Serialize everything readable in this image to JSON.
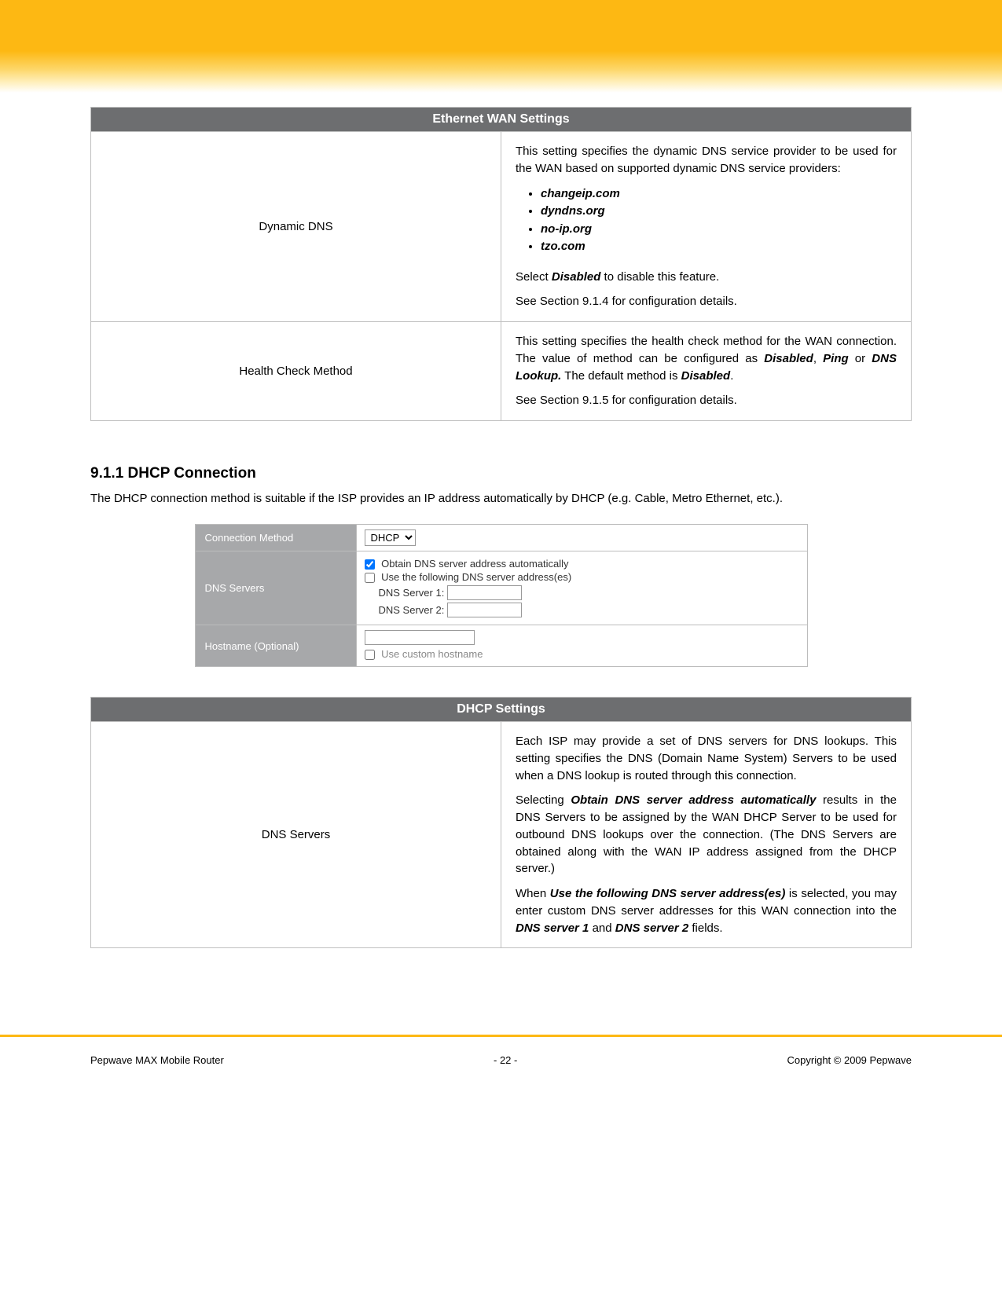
{
  "tables": {
    "ethernet": {
      "title": "Ethernet WAN Settings",
      "rows": [
        {
          "label": "Dynamic DNS",
          "intro": "This setting specifies the dynamic DNS service provider to be used for the WAN based on supported dynamic DNS service providers:",
          "items": [
            "changeip.com",
            "dyndns.org",
            "no-ip.org",
            "tzo.com"
          ],
          "p2_a": "Select ",
          "p2_b": "Disabled",
          "p2_c": " to disable this feature.",
          "p3": "See Section 9.1.4 for configuration details."
        },
        {
          "label": "Health Check Method",
          "p1_a": "This setting specifies the health check method for the WAN connection.  The value of method can be configured as ",
          "p1_b": "Disabled",
          "p1_c": ", ",
          "p1_d": "Ping",
          "p1_e": " or ",
          "p1_f": "DNS Lookup.",
          "p1_g": "  The default method is ",
          "p1_h": "Disabled",
          "p1_i": ".",
          "p2": "See Section 9.1.5 for configuration details."
        }
      ]
    },
    "dhcp": {
      "title": "DHCP Settings",
      "rows": [
        {
          "label": "DNS Servers",
          "p1": "Each ISP may provide a set of DNS servers for DNS lookups.  This setting specifies the DNS (Domain Name System) Servers to be used when a DNS lookup is routed through this connection.",
          "p2_a": "Selecting ",
          "p2_b": "Obtain DNS server address automatically",
          "p2_c": " results in the DNS Servers to be assigned by the WAN DHCP Server to be used for outbound DNS lookups over the connection.  (The DNS Servers are obtained along with the WAN IP address assigned from the DHCP server.)",
          "p3_a": "When ",
          "p3_b": "Use the following DNS server address(es)",
          "p3_c": " is selected, you may enter custom DNS server addresses for this WAN connection into the ",
          "p3_d": "DNS server 1",
          "p3_e": " and ",
          "p3_f": "DNS server 2",
          "p3_g": " fields."
        }
      ]
    }
  },
  "section": {
    "heading": "9.1.1  DHCP Connection",
    "intro": "The DHCP connection method is suitable if the ISP provides an IP address automatically by DHCP (e.g. Cable, Metro Ethernet, etc.)."
  },
  "form": {
    "conn_method_label": "Connection Method",
    "conn_method_value": "DHCP",
    "dns_servers_label": "DNS Servers",
    "obtain_auto": "Obtain DNS server address automatically",
    "use_following": "Use the following DNS server address(es)",
    "dns1_label": "DNS Server 1:",
    "dns2_label": "DNS Server 2:",
    "hostname_label": "Hostname (Optional)",
    "use_custom_hostname": "Use custom hostname"
  },
  "footer": {
    "left": "Pepwave MAX Mobile Router",
    "center": "- 22 -",
    "right": "Copyright © 2009 Pepwave"
  }
}
